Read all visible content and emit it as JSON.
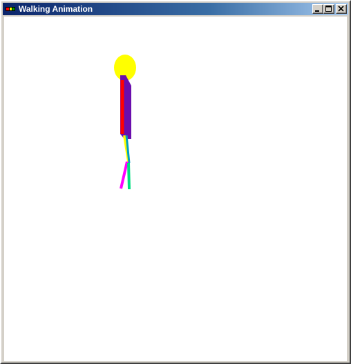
{
  "window": {
    "title": "Walking Animation",
    "buttons": {
      "minimize": "minimize-icon",
      "maximize": "maximize-icon",
      "close": "close-icon"
    }
  },
  "figure": {
    "head_color": "#ffff00",
    "torso_color": "#6a0dad",
    "arm_color": "#ff0000",
    "upper_leg_colors": [
      "#ffff00",
      "#00a0c0"
    ],
    "lower_leg_colors": [
      "#ff00ff",
      "#00e080"
    ]
  }
}
